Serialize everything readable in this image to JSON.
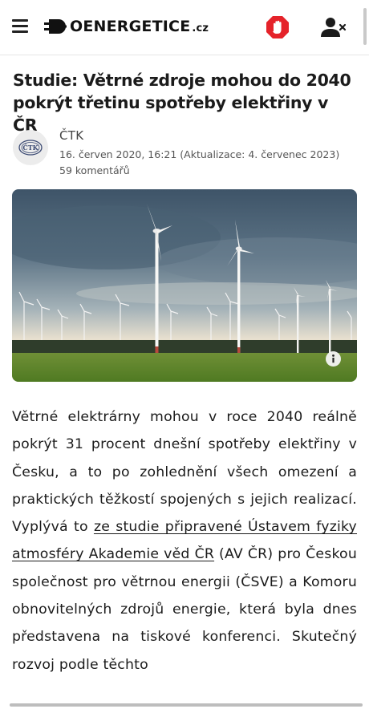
{
  "header": {
    "logo_text": "OENERGETICE",
    "logo_suffix": ".cz",
    "icons": {
      "menu": "hamburger-icon",
      "adblock": "stop-hand-icon",
      "user": "user-remove-icon"
    },
    "adblock_color": "#e5232a"
  },
  "article": {
    "title": "Studie: Větrné zdroje mohou do 2040 pokrýt třetinu spotřeby elektřiny v ČR",
    "author": "ČTK",
    "avatar_text": "ČTK",
    "date": "16. červen 2020, 16:21 (Aktualizace: 4. červenec 2023)",
    "comments": "59 komentářů",
    "body_start": "Větrné elektrárny mohou v roce 2040 reálně pokrýt 31 procent dnešní spotřeby elektřiny v Česku, a to po zohlednění všech omezení a praktických těžkostí spojených s jejich realizací. Vyplývá to ",
    "body_link": "ze studie připravené Ústavem fyziky atmosféry Akademie věd ČR",
    "body_end": " (AV ČR) pro Českou společnost pro větrnou energii (ČSVE) a Komoru obnovitelných zdrojů energie, která byla dnes představena na tiskové konferenci. Skutečný rozvoj podle těchto"
  }
}
